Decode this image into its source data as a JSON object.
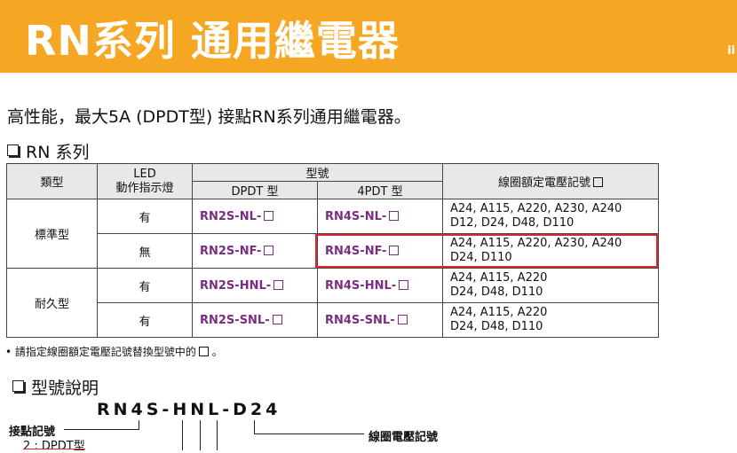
{
  "banner": {
    "title": "RN系列 通用繼電器",
    "edge_text": "ii"
  },
  "intro": "高性能，最大5A (DPDT型) 接點RN系列通用繼電器。",
  "section1_title": "RN 系列",
  "table": {
    "headers": {
      "type": "類型",
      "led_line1": "LED",
      "led_line2": "動作指示燈",
      "model": "型號",
      "dpdt": "DPDT 型",
      "fourpdt": "4PDT 型",
      "coil": "線圈額定電壓記號"
    },
    "groups": [
      {
        "type": "標準型",
        "rows": [
          {
            "led": "有",
            "dpdt": "RN2S-NL-",
            "fourpdt": "RN4S-NL-",
            "coil": [
              "A24, A115, A220, A230, A240",
              "D12, D24, D48, D110"
            ]
          },
          {
            "led": "無",
            "dpdt": "RN2S-NF-",
            "fourpdt": "RN4S-NF-",
            "coil": [
              "A24, A115, A220, A230, A240",
              "D24, D110"
            ]
          }
        ]
      },
      {
        "type": "耐久型",
        "rows": [
          {
            "led": "有",
            "dpdt": "RN2S-HNL-",
            "fourpdt": "RN4S-HNL-",
            "coil": [
              "A24, A115, A220",
              "D24, D48, D110"
            ]
          },
          {
            "led": "有",
            "dpdt": "RN2S-SNL-",
            "fourpdt": "RN4S-SNL-",
            "coil": [
              "A24, A115, A220",
              "D24, D48, D110"
            ]
          }
        ]
      }
    ]
  },
  "note": "請指定線圈額定電壓記號替換型號中的",
  "note_tail": "。",
  "section2_title": "型號說明",
  "model_code": "RN4S-HNL-D24",
  "contact_label": "接點記號",
  "contact_option": "2 : DPDT型",
  "coil_voltage_label": "線圈電壓記號",
  "colors": {
    "banner": "#f5a623",
    "model_text": "#7b2d82",
    "highlight": "#e0252f",
    "header_bg": "#e8e8e8"
  }
}
